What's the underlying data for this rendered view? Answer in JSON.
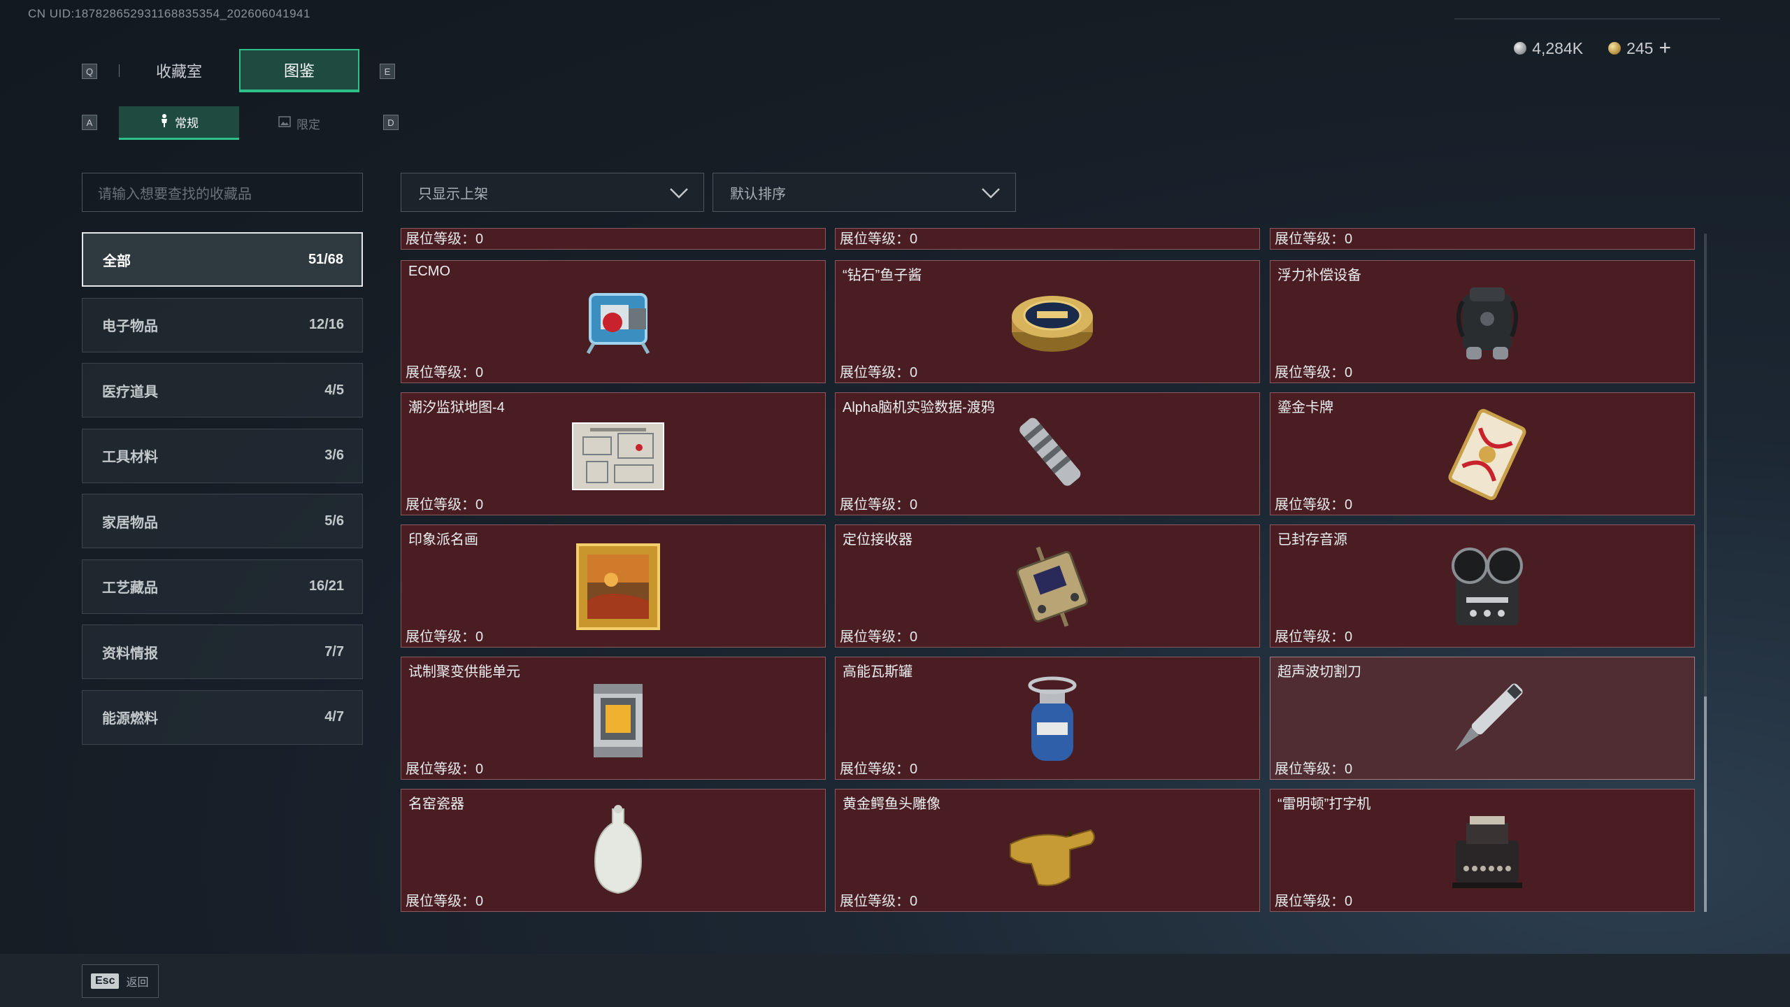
{
  "uid_text": "CN UID:18782865293116883535​4_202606041941",
  "keys": {
    "prev_tab": "Q",
    "next_tab": "E",
    "prev_sub": "A",
    "next_sub": "D"
  },
  "tabs": [
    {
      "label": "收藏室",
      "active": false
    },
    {
      "label": "图鉴",
      "active": true
    }
  ],
  "subtabs": [
    {
      "label": "常规",
      "icon": "figure-icon",
      "active": true
    },
    {
      "label": "限定",
      "icon": "image-icon",
      "active": false
    }
  ],
  "currency": {
    "silver": {
      "icon": "silver-coin-icon",
      "value": "4,284K"
    },
    "gold": {
      "icon": "gold-coin-icon",
      "value": "245"
    },
    "plus": "+"
  },
  "search": {
    "placeholder": "请输入想要查找的收藏品"
  },
  "filters": {
    "shelf": {
      "value": "只显示上架"
    },
    "sort": {
      "value": "默认排序"
    }
  },
  "categories": [
    {
      "label": "全部",
      "count": "51/68",
      "active": true
    },
    {
      "label": "电子物品",
      "count": "12/16",
      "active": false
    },
    {
      "label": "医疗道具",
      "count": "4/5",
      "active": false
    },
    {
      "label": "工具材料",
      "count": "3/6",
      "active": false
    },
    {
      "label": "家居物品",
      "count": "5/6",
      "active": false
    },
    {
      "label": "工艺藏品",
      "count": "16/21",
      "active": false
    },
    {
      "label": "资料情报",
      "count": "7/7",
      "active": false
    },
    {
      "label": "能源燃料",
      "count": "4/7",
      "active": false
    }
  ],
  "level_prefix": "展位等级：",
  "partial_row": [
    {
      "level": "0"
    },
    {
      "level": "0"
    },
    {
      "level": "0"
    }
  ],
  "items": [
    {
      "name": "ECMO",
      "level": "0",
      "icon": "ecmo-icon"
    },
    {
      "name": "“钻石”鱼子酱",
      "level": "0",
      "icon": "caviar-tin-icon"
    },
    {
      "name": "浮力补偿设备",
      "level": "0",
      "icon": "bcd-vest-icon"
    },
    {
      "name": "潮汐监狱地图-4",
      "level": "0",
      "icon": "map-icon"
    },
    {
      "name": "Alpha脑机实验数据-渡鸦",
      "level": "0",
      "icon": "data-cylinder-icon"
    },
    {
      "name": "鎏金卡牌",
      "level": "0",
      "icon": "gold-card-icon"
    },
    {
      "name": "印象派名画",
      "level": "0",
      "icon": "painting-icon"
    },
    {
      "name": "定位接收器",
      "level": "0",
      "icon": "receiver-icon"
    },
    {
      "name": "已封存音源",
      "level": "0",
      "icon": "reel-recorder-icon"
    },
    {
      "name": "试制聚变供能单元",
      "level": "0",
      "icon": "fusion-cell-icon"
    },
    {
      "name": "高能瓦斯罐",
      "level": "0",
      "icon": "gas-canister-icon"
    },
    {
      "name": "超声波切割刀",
      "level": "0",
      "icon": "ultrasonic-knife-icon",
      "hover": true
    },
    {
      "name": "名窑瓷器",
      "level": "0",
      "icon": "porcelain-vase-icon"
    },
    {
      "name": "黄金鳄鱼头雕像",
      "level": "0",
      "icon": "gold-crocodile-icon"
    },
    {
      "name": "“雷明顿”打字机",
      "level": "0",
      "icon": "typewriter-icon"
    }
  ],
  "footer": {
    "esc_key": "Esc",
    "back_label": "返回"
  },
  "colors": {
    "accent": "#2fbf8a",
    "card_bg": "#4a1d23",
    "card_border": "#8a5a5f"
  }
}
